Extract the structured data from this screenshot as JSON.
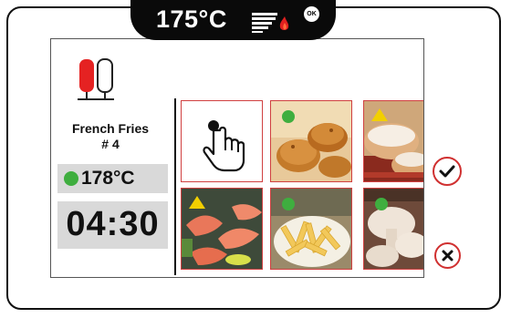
{
  "header": {
    "set_temperature": "175°C",
    "ok_badge": "OK",
    "heating_icon": "heating-flame-icon"
  },
  "product": {
    "name": "French Fries",
    "number": "# 4",
    "fryer_icon": "fryer-baskets-icon"
  },
  "status": {
    "current_temperature": "178°C",
    "temperature_indicator_color": "#3fae3f",
    "timer": "04:30"
  },
  "tiles": [
    {
      "id": "touch",
      "icon": "hand-pointer-icon",
      "indicator": "none"
    },
    {
      "id": "croquettes",
      "indicator": "ready"
    },
    {
      "id": "donuts",
      "indicator": "warning"
    },
    {
      "id": "shrimp",
      "indicator": "warning"
    },
    {
      "id": "fries",
      "indicator": "ready"
    },
    {
      "id": "mushrooms",
      "indicator": "ready"
    }
  ],
  "actions": {
    "confirm_icon": "check-icon",
    "cancel_icon": "close-icon"
  },
  "colors": {
    "accent_red": "#d03030",
    "ready_green": "#3fae3f",
    "warning_yellow": "#f2cf00",
    "panel_grey": "#d9d9d9"
  }
}
